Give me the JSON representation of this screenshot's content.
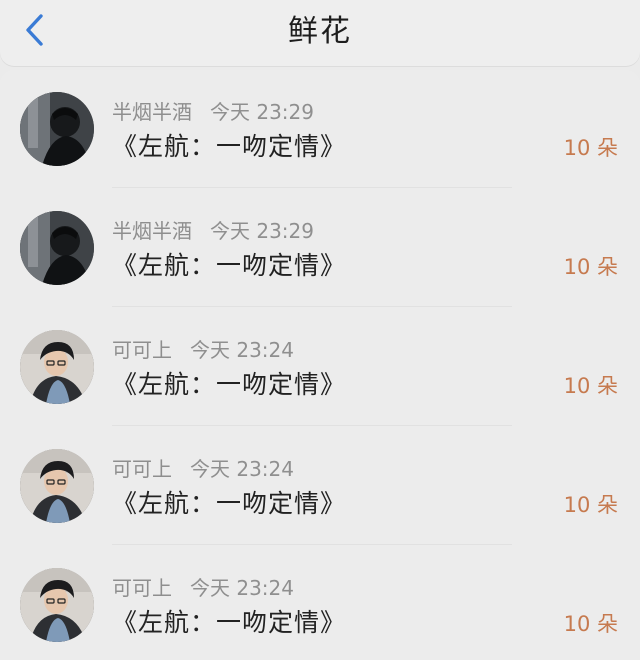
{
  "header": {
    "title": "鲜花",
    "back_icon": "chevron-left-icon",
    "accent_color": "#3a7bd5"
  },
  "rows": [
    {
      "user": "半烟半酒",
      "time": "今天 23:29",
      "gift": "《左航：一吻定情》",
      "count": "10 朵",
      "avatar": "dark-silhouette"
    },
    {
      "user": "半烟半酒",
      "time": "今天 23:29",
      "gift": "《左航：一吻定情》",
      "count": "10 朵",
      "avatar": "dark-silhouette"
    },
    {
      "user": "可可上",
      "time": "今天 23:24",
      "gift": "《左航：一吻定情》",
      "count": "10 朵",
      "avatar": "boy-portrait"
    },
    {
      "user": "可可上",
      "time": "今天 23:24",
      "gift": "《左航：一吻定情》",
      "count": "10 朵",
      "avatar": "boy-portrait"
    },
    {
      "user": "可可上",
      "time": "今天 23:24",
      "gift": "《左航：一吻定情》",
      "count": "10 朵",
      "avatar": "boy-portrait"
    }
  ],
  "colors": {
    "count": "#c67a4f",
    "meta": "#8e8e8e",
    "title": "#1d1d1d"
  }
}
